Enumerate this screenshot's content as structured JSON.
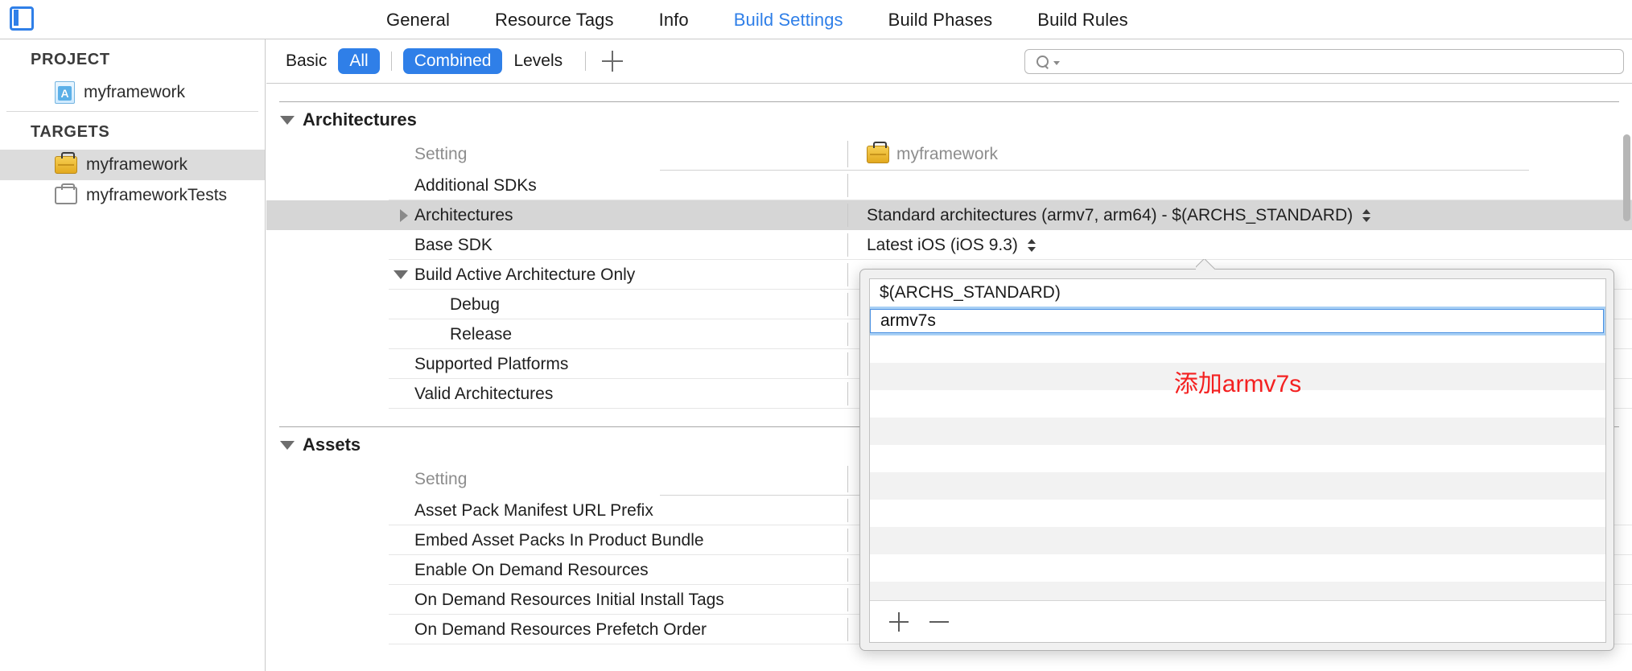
{
  "window": {
    "nav_toggle_icon": "navigator-toggle-icon"
  },
  "tabs": [
    {
      "label": "General",
      "active": false
    },
    {
      "label": "Resource Tags",
      "active": false
    },
    {
      "label": "Info",
      "active": false
    },
    {
      "label": "Build Settings",
      "active": true
    },
    {
      "label": "Build Phases",
      "active": false
    },
    {
      "label": "Build Rules",
      "active": false
    }
  ],
  "sidebar": {
    "project_header": "PROJECT",
    "project_items": [
      {
        "label": "myframework",
        "icon": "xcode-project-icon"
      }
    ],
    "targets_header": "TARGETS",
    "target_items": [
      {
        "label": "myframework",
        "icon": "target-framework-icon",
        "selected": true
      },
      {
        "label": "myframeworkTests",
        "icon": "target-test-icon",
        "selected": false
      }
    ]
  },
  "filter_bar": {
    "basic": "Basic",
    "all": "All",
    "combined": "Combined",
    "levels": "Levels",
    "add_icon": "plus-icon",
    "search_icon": "search-icon",
    "search_value": "",
    "search_placeholder": ""
  },
  "columns": {
    "setting": "Setting",
    "target": "myframework"
  },
  "groups": [
    {
      "title": "Architectures",
      "expanded": true,
      "rows": [
        {
          "name": "Additional SDKs",
          "value": "",
          "indent": 0,
          "disclosure": "none",
          "selected": false
        },
        {
          "name": "Architectures",
          "value": "Standard architectures (armv7, arm64)  -  $(ARCHS_STANDARD)",
          "indent": 0,
          "disclosure": "collapsed",
          "selected": true,
          "stepper": true
        },
        {
          "name": "Base SDK",
          "value": "Latest iOS (iOS 9.3)",
          "indent": 0,
          "disclosure": "none",
          "selected": false,
          "stepper": true
        },
        {
          "name": "Build Active Architecture Only",
          "value": "",
          "indent": 0,
          "disclosure": "expanded",
          "selected": false
        },
        {
          "name": "Debug",
          "value": "",
          "indent": 1,
          "disclosure": "none",
          "selected": false
        },
        {
          "name": "Release",
          "value": "",
          "indent": 1,
          "disclosure": "none",
          "selected": false
        },
        {
          "name": "Supported Platforms",
          "value": "",
          "indent": 0,
          "disclosure": "none",
          "selected": false
        },
        {
          "name": "Valid Architectures",
          "value": "",
          "indent": 0,
          "disclosure": "none",
          "selected": false
        }
      ]
    },
    {
      "title": "Assets",
      "expanded": true,
      "rows": [
        {
          "name": "Asset Pack Manifest URL Prefix",
          "value": "",
          "indent": 0,
          "disclosure": "none",
          "selected": false
        },
        {
          "name": "Embed Asset Packs In Product Bundle",
          "value": "",
          "indent": 0,
          "disclosure": "none",
          "selected": false
        },
        {
          "name": "Enable On Demand Resources",
          "value": "",
          "indent": 0,
          "disclosure": "none",
          "selected": false
        },
        {
          "name": "On Demand Resources Initial Install Tags",
          "value": "",
          "indent": 0,
          "disclosure": "none",
          "selected": false
        },
        {
          "name": "On Demand Resources Prefetch Order",
          "value": "",
          "indent": 0,
          "disclosure": "none",
          "selected": false
        }
      ]
    }
  ],
  "popover": {
    "entries": [
      {
        "text": "$(ARCHS_STANDARD)",
        "editing": false
      },
      {
        "text": "armv7s",
        "editing": true
      }
    ],
    "annotation": "添加armv7s",
    "annotation_color": "#f42020",
    "add_button_icon": "plus-icon",
    "remove_button_icon": "minus-icon"
  }
}
